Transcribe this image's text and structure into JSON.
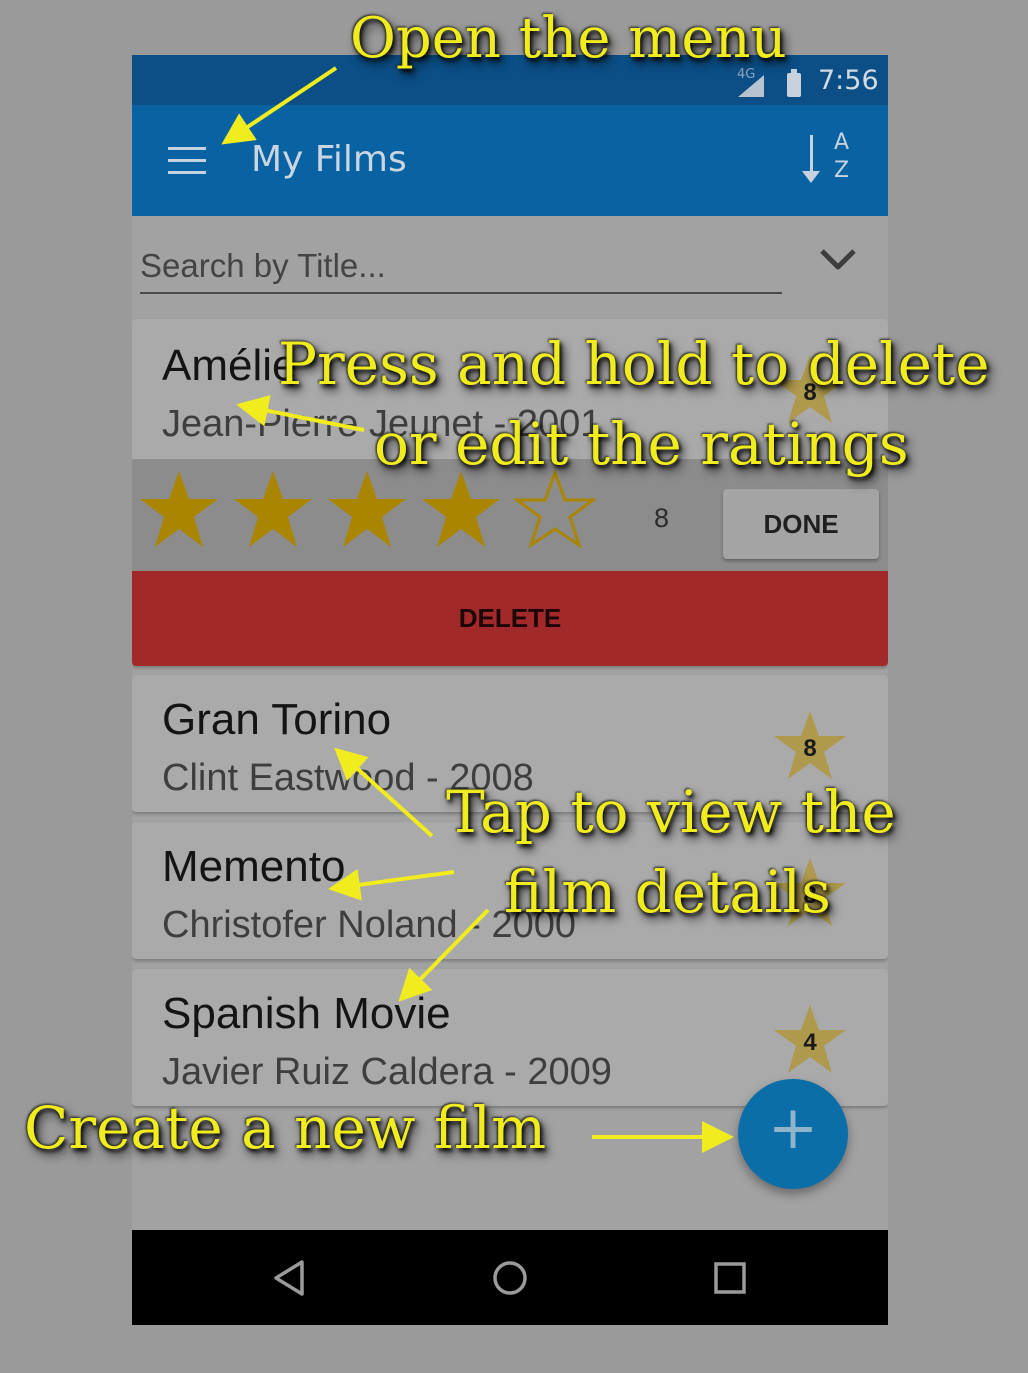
{
  "status_bar": {
    "network": "4G",
    "time": "7:56"
  },
  "app_bar": {
    "title": "My Films",
    "menu_icon": "hamburger-menu-icon",
    "sort_icon": "sort-alphabetical-icon"
  },
  "search": {
    "placeholder": "Search by Title...",
    "dropdown_icon": "chevron-down-icon"
  },
  "films": [
    {
      "title": "Amélie",
      "director_year": "Jean-Pierre Jeunet - 2001",
      "rating": "8"
    },
    {
      "title": "Gran Torino",
      "director_year": "Clint Eastwood - 2008",
      "rating": "8"
    },
    {
      "title": "Memento",
      "director_year": "Christofer Noland - 2000",
      "rating": "8"
    },
    {
      "title": "Spanish Movie",
      "director_year": "Javier Ruiz Caldera - 2009",
      "rating": "4"
    }
  ],
  "rating_editor": {
    "stars_filled": 4,
    "stars_total": 5,
    "value": "8",
    "done_label": "DONE"
  },
  "delete_label": "DELETE",
  "fab_label": "+",
  "nav_bar": {
    "back_icon": "back-triangle-icon",
    "home_icon": "home-circle-icon",
    "recents_icon": "recents-square-icon"
  },
  "annotations": {
    "open_menu": "Open the menu",
    "press_hold_line1": "Press and hold to delete",
    "press_hold_line2": "or edit the ratings",
    "tap_line1": "Tap to view the",
    "tap_line2": "film details",
    "create": "Create a new film"
  },
  "colors": {
    "overlay_gray": "#9a9a9a",
    "app_bar": "#0963a2",
    "delete": "#a2292a",
    "star": "#b08a00",
    "annotation": "#f1ec1e",
    "fab": "#0b6ea8"
  }
}
